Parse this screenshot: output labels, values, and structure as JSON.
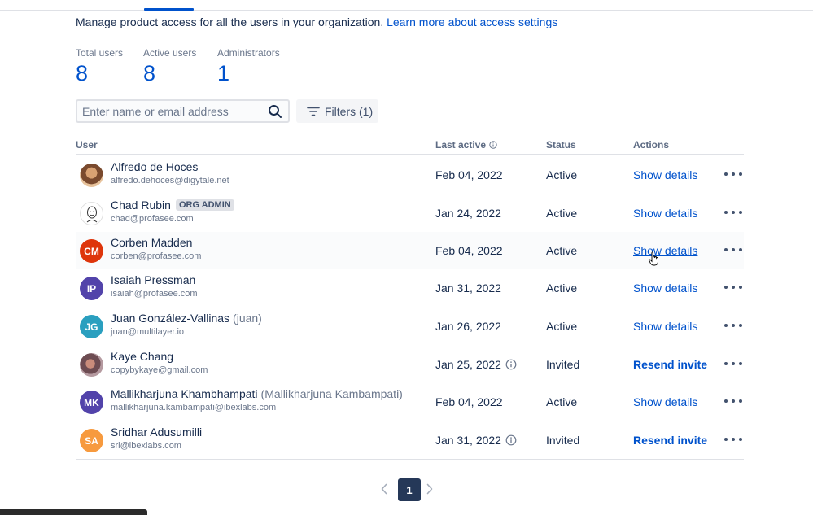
{
  "intro": {
    "text": "Manage product access for all the users in your organization.",
    "link": "Learn more about access settings"
  },
  "stats": [
    {
      "label": "Total users",
      "value": "8"
    },
    {
      "label": "Active users",
      "value": "8"
    },
    {
      "label": "Administrators",
      "value": "1"
    }
  ],
  "search": {
    "placeholder": "Enter name or email address",
    "value": ""
  },
  "filters": {
    "label": "Filters (1)"
  },
  "table": {
    "headers": {
      "user": "User",
      "last_active": "Last active",
      "status": "Status",
      "actions": "Actions"
    },
    "rows": [
      {
        "name": "Alfredo de Hoces",
        "nickname": "",
        "badge": "",
        "email": "alfredo.dehoces@digytale.net",
        "initials": "",
        "avatar_color": "",
        "last_active": "Feb 04, 2022",
        "status": "Active",
        "action": "Show details"
      },
      {
        "name": "Chad Rubin",
        "nickname": "",
        "badge": "ORG ADMIN",
        "email": "chad@profasee.com",
        "initials": "",
        "avatar_color": "",
        "last_active": "Jan 24, 2022",
        "status": "Active",
        "action": "Show details"
      },
      {
        "name": "Corben Madden",
        "nickname": "",
        "badge": "",
        "email": "corben@profasee.com",
        "initials": "CM",
        "avatar_color": "#de350b",
        "last_active": "Feb 04, 2022",
        "status": "Active",
        "action": "Show details"
      },
      {
        "name": "Isaiah Pressman",
        "nickname": "",
        "badge": "",
        "email": "isaiah@profasee.com",
        "initials": "IP",
        "avatar_color": "#5243aa",
        "last_active": "Jan 31, 2022",
        "status": "Active",
        "action": "Show details"
      },
      {
        "name": "Juan González-Vallinas",
        "nickname": "(juan)",
        "badge": "",
        "email": "juan@multilayer.io",
        "initials": "JG",
        "avatar_color": "#2a9fbf",
        "last_active": "Jan 26, 2022",
        "status": "Active",
        "action": "Show details"
      },
      {
        "name": "Kaye Chang",
        "nickname": "",
        "badge": "",
        "email": "copybykaye@gmail.com",
        "initials": "",
        "avatar_color": "",
        "last_active": "Jan 25, 2022",
        "status": "Invited",
        "action": "Resend invite"
      },
      {
        "name": "Mallikharjuna Khambhampati",
        "nickname": "(Mallikharjuna Kambampati)",
        "badge": "",
        "email": "mallikharjuna.kambampati@ibexlabs.com",
        "initials": "MK",
        "avatar_color": "#5243aa",
        "last_active": "Feb 04, 2022",
        "status": "Active",
        "action": "Show details"
      },
      {
        "name": "Sridhar Adusumilli",
        "nickname": "",
        "badge": "",
        "email": "sri@ibexlabs.com",
        "initials": "SA",
        "avatar_color": "#f79a3e",
        "last_active": "Jan 31, 2022",
        "status": "Invited",
        "action": "Resend invite"
      }
    ]
  },
  "pagination": {
    "current_page": "1"
  },
  "colors": {
    "accent": "#0052cc",
    "text": "#172b4d",
    "muted": "#6b778c"
  },
  "icons": [
    "search-icon",
    "filter-icon",
    "info-icon",
    "more-icon",
    "chevron-left-icon",
    "chevron-right-icon",
    "hand-cursor-icon"
  ]
}
